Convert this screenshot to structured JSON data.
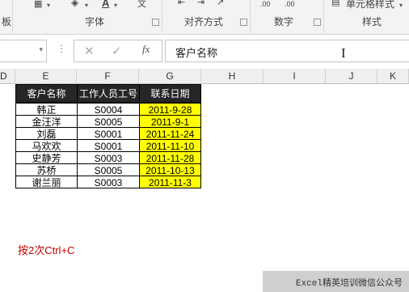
{
  "ribbon": {
    "groups": [
      {
        "label": "板"
      },
      {
        "label": "字体"
      },
      {
        "label": "对齐方式"
      },
      {
        "label": "数字"
      },
      {
        "label": "样式"
      }
    ],
    "cell_styles_label": "单元格样式",
    "number_decimals_a": ".00",
    "number_decimals_b": ".00"
  },
  "formula_bar": {
    "cancel_glyph": "✕",
    "enter_glyph": "✓",
    "fx_label": "fx",
    "value": "客户名称"
  },
  "columns": [
    "D",
    "E",
    "F",
    "G",
    "H",
    "I",
    "J",
    "K"
  ],
  "table": {
    "headers": [
      "客户名称",
      "工作人员工号",
      "联系日期"
    ],
    "rows": [
      [
        "韩正",
        "S0004",
        "2011-9-28"
      ],
      [
        "金汪洋",
        "S0005",
        "2011-9-1"
      ],
      [
        "刘磊",
        "S0001",
        "2011-11-24"
      ],
      [
        "马欢欢",
        "S0001",
        "2011-11-10"
      ],
      [
        "史静芳",
        "S0003",
        "2011-11-28"
      ],
      [
        "苏桥",
        "S0005",
        "2011-10-13"
      ],
      [
        "谢兰丽",
        "S0003",
        "2011-11-3"
      ]
    ],
    "date_highlight_color": "#ffff00",
    "header_bg_color": "#262626"
  },
  "note": "按2次Ctrl+C",
  "watermark": "Excel精英培训微信公众号"
}
